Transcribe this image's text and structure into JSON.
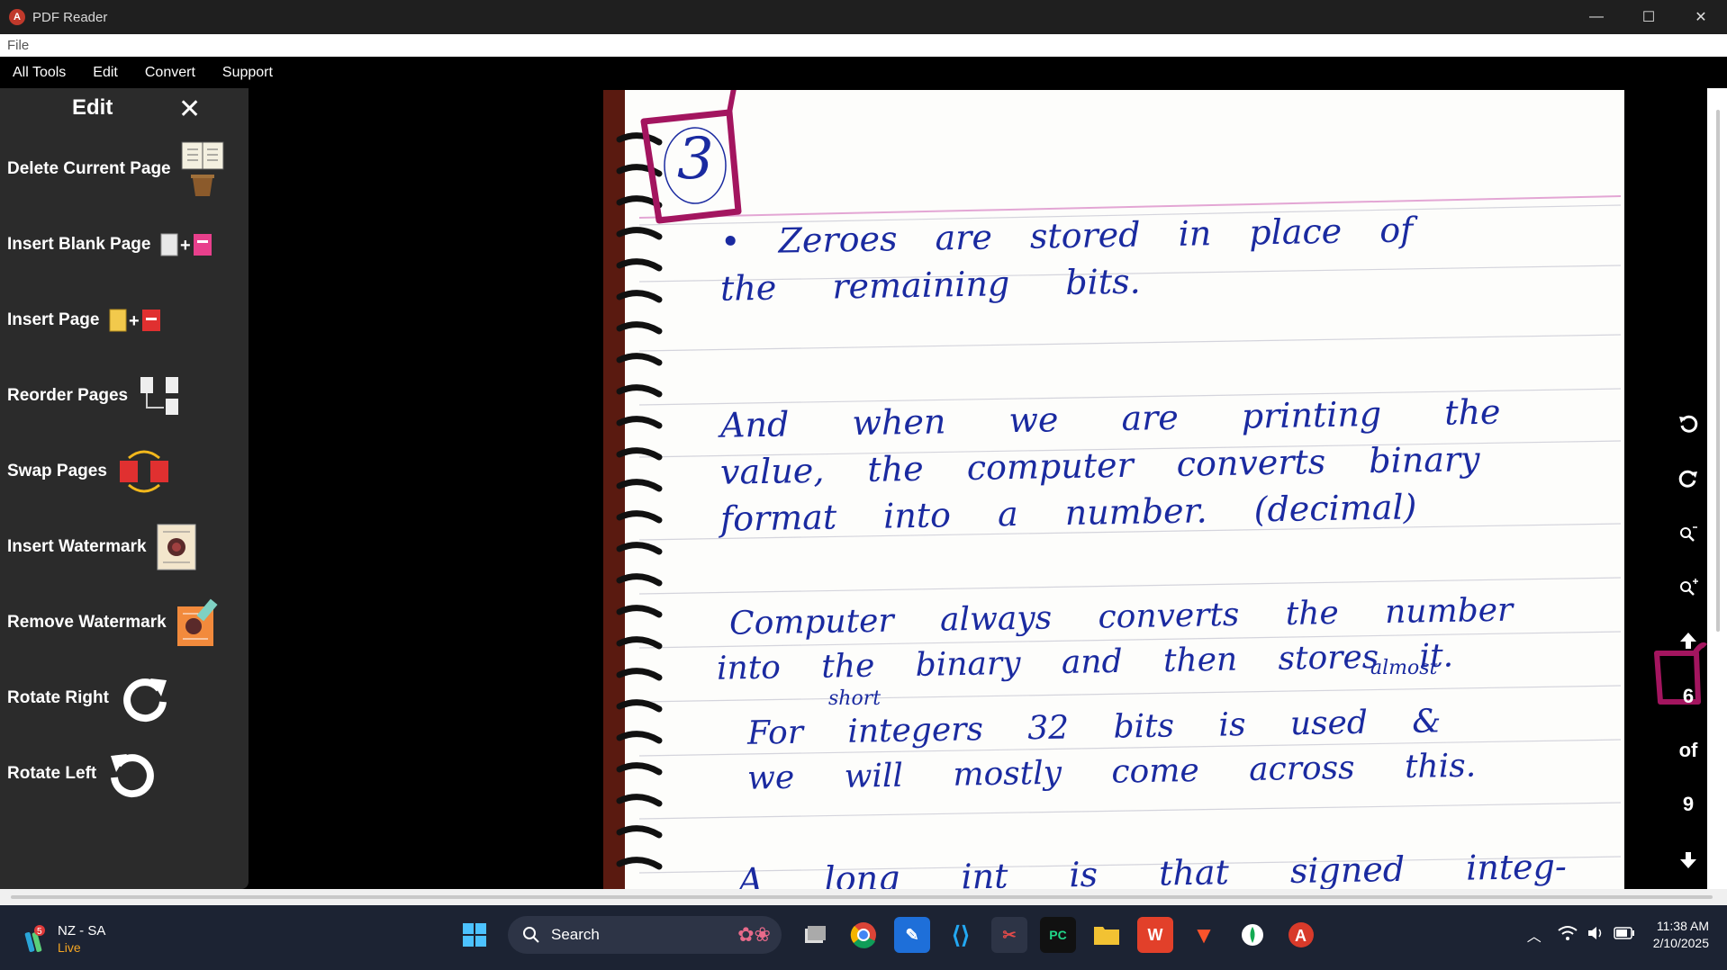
{
  "window": {
    "title": "PDF Reader",
    "icon": "pdf-app-icon",
    "minimize": "—",
    "maximize": "☐",
    "close": "✕"
  },
  "filebar": {
    "label": "File"
  },
  "menu": {
    "items": [
      "All Tools",
      "Edit",
      "Convert",
      "Support"
    ]
  },
  "edit_panel": {
    "title": "Edit",
    "close": "✕",
    "tools": [
      "Delete Current Page",
      "Insert Blank Page",
      "Insert Page",
      "Reorder Pages",
      "Swap Pages",
      "Insert Watermark",
      "Remove Watermark",
      "Rotate Right",
      "Rotate Left"
    ]
  },
  "document": {
    "page_number_circled": "3",
    "lines": [
      "• Zeroes are stored in place of",
      "the remaining bits.",
      "And when we are printing the",
      "value, the computer converts binary",
      "format into a number. (decimal)",
      "Computer always converts the number",
      "into the binary and then stores it.",
      "almost",
      "short",
      "For integers 32 bits is used &",
      "we will mostly come across this.",
      "A long int is that signed integ-"
    ]
  },
  "navigation": {
    "current_page": "6",
    "of_label": "of",
    "total_pages": "9"
  },
  "taskbar": {
    "weather_badge": "5",
    "weather_title": "NZ - SA",
    "weather_sub": "Live",
    "search_label": "Search",
    "time": "11:38 AM",
    "date": "2/10/2025"
  },
  "colors": {
    "ink": "#1a2aa0",
    "annotation": "#a3155f",
    "panel_bg": "#2b2b2b",
    "taskbar_bg": "#1c2333"
  }
}
